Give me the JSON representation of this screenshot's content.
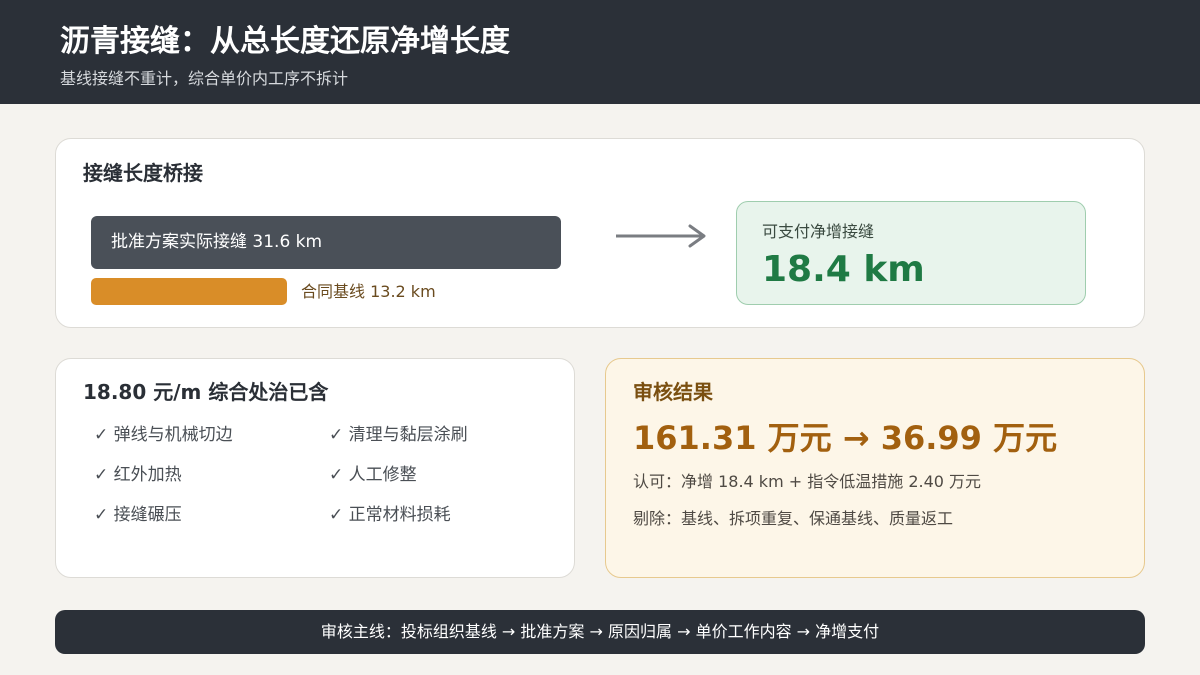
{
  "header": {
    "title": "沥青接缝：从总长度还原净增长度",
    "subtitle": "基线接缝不重计，综合单价内工序不拆计"
  },
  "bridge": {
    "title": "接缝长度桥接",
    "total_bar_label": "批准方案实际接缝 31.6 km",
    "base_bar_label": "合同基线 13.2 km",
    "net_label": "可支付净增接缝",
    "net_value": "18.4 km",
    "arrow_icon": "arrow-right-icon",
    "colors": {
      "total": "#4a5058",
      "base": "#d98d28",
      "net": "#1f7a44"
    }
  },
  "scope": {
    "title": "18.80 元/m 综合处治已含",
    "items": [
      "✓ 弹线与机械切边",
      "✓ 清理与黏层涂刷",
      "✓ 红外加热",
      "✓ 人工修整",
      "✓ 接缝碾压",
      "✓ 正常材料损耗"
    ]
  },
  "result": {
    "title": "审核结果",
    "amount": "161.31 万元 → 36.99 万元",
    "approved": "认可：净增 18.4 km + 指令低温措施 2.40 万元",
    "removed": "剔除：基线、拆项重复、保通基线、质量返工"
  },
  "footer": {
    "text": "审核主线：投标组织基线 → 批准方案 → 原因归属 → 单价工作内容 → 净增支付"
  }
}
